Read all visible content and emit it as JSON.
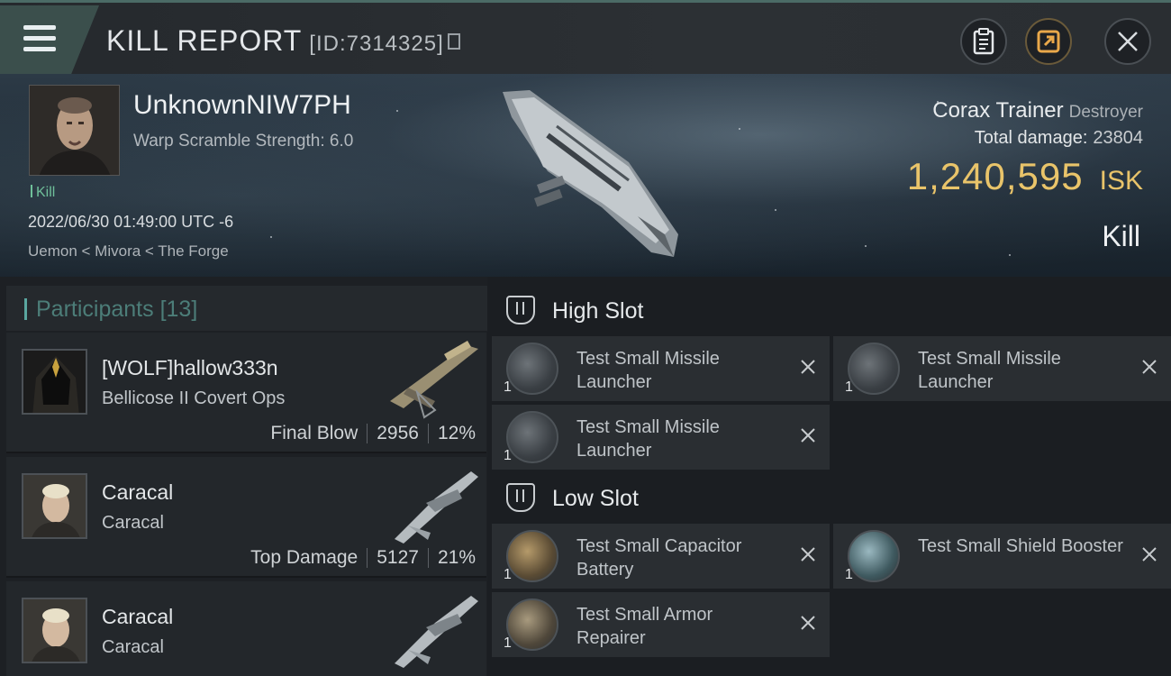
{
  "header": {
    "title": "KILL REPORT",
    "report_id": "[ID:7314325]"
  },
  "victim": {
    "name": "UnknownNIW7PH",
    "warp_scramble": "Warp Scramble Strength: 6.0",
    "kill_tag": "Kill",
    "timestamp": "2022/06/30 01:49:00 UTC -6",
    "location": "Uemon < Mivora < The Forge",
    "ship_name": "Corax Trainer",
    "ship_class": "Destroyer",
    "damage_label": "Total damage:",
    "damage_value": "23804",
    "isk_value": "1,240,595",
    "isk_unit": "ISK",
    "result": "Kill"
  },
  "participants": {
    "title": "Participants",
    "count": "[13]",
    "items": [
      {
        "name": "[WOLF]hallow333n",
        "ship": "Bellicose II Covert Ops",
        "role": "Final Blow",
        "damage": "2956",
        "percent": "12%"
      },
      {
        "name": "Caracal",
        "ship": "Caracal",
        "role": "Top Damage",
        "damage": "5127",
        "percent": "21%"
      },
      {
        "name": "Caracal",
        "ship": "Caracal",
        "role": "",
        "damage": "",
        "percent": ""
      }
    ]
  },
  "slots": {
    "high": {
      "title": "High Slot",
      "modules": [
        {
          "name": "Test Small Missile Launcher",
          "qty": "1"
        },
        {
          "name": "Test Small Missile Launcher",
          "qty": "1"
        },
        {
          "name": "Test Small Missile Launcher",
          "qty": "1"
        }
      ]
    },
    "low": {
      "title": "Low Slot",
      "modules": [
        {
          "name": "Test Small Capacitor Battery",
          "qty": "1"
        },
        {
          "name": "Test Small Shield Booster",
          "qty": "1"
        },
        {
          "name": "Test Small Armor Repairer",
          "qty": "1"
        }
      ]
    }
  },
  "colors": {
    "accent_teal": "#5aa7a0",
    "isk_gold": "#e9c46a",
    "kill_green": "#6fbf9a"
  }
}
